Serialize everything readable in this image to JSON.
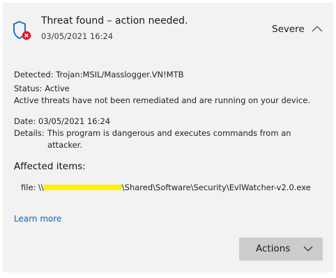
{
  "header": {
    "title": "Threat found – action needed.",
    "timestamp": "03/05/2021 16:24",
    "severity": "Severe",
    "icons": {
      "status": "shield-error-icon",
      "collapse": "chevron-up-icon"
    }
  },
  "details": {
    "detected_label": "Detected:",
    "detected_value": "Trojan:MSIL/Masslogger.VN!MTB",
    "status_label": "Status:",
    "status_value": "Active",
    "status_note": "Active threats have not been remediated and are running on your device.",
    "date_label": "Date:",
    "date_value": "03/05/2021 16:24",
    "details_label": "Details:",
    "details_line1": "This program is dangerous and executes commands from an",
    "details_line2": "attacker."
  },
  "affected": {
    "heading": "Affected items:",
    "file_prefix": "file: \\\\",
    "file_suffix": "\\Shared\\Software\\Security\\EvlWatcher-v2.0.exe"
  },
  "links": {
    "learn_more": "Learn more"
  },
  "actions": {
    "label": "Actions",
    "icon": "chevron-down-icon"
  },
  "colors": {
    "panel_bg": "#f2f2f2",
    "shield": "#1a73c7",
    "error_badge": "#e81123",
    "link": "#0a64c0",
    "button_bg": "#cccccc",
    "redaction": "#ffef00"
  }
}
